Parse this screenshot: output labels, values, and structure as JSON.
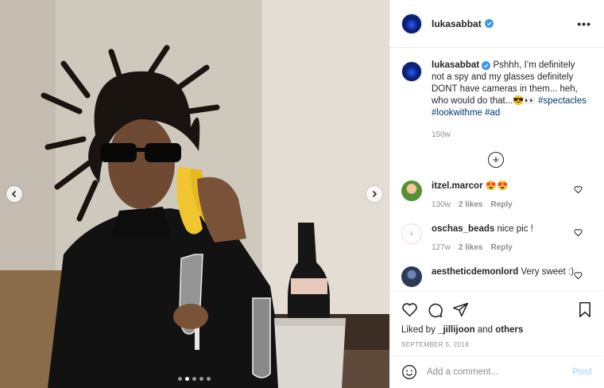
{
  "post": {
    "username": "lukasabbat",
    "verified": true,
    "more_icon": "more-horizontal-icon",
    "caption": {
      "text": "Pshhh, I’m definitely not a spy and my glasses definitely DONT have cameras in them... heh, who would do that...😎👀",
      "hashtags": [
        "#spectacles",
        "#lookwithme",
        "#ad"
      ],
      "time": "150w"
    },
    "load_more_icon": "plus-circle-icon",
    "comments": [
      {
        "username": "itzel.marcor",
        "text": "😍😍",
        "time": "130w",
        "likes": "2 likes",
        "reply": "Reply",
        "avatar_color": "#5a8f3a"
      },
      {
        "username": "oschas_beads",
        "text": "nice pic !",
        "time": "127w",
        "likes": "2 likes",
        "reply": "Reply",
        "avatar_color": "#f3d7e6"
      },
      {
        "username": "aestheticdemonlord",
        "text": "Very sweet :)",
        "time": "",
        "likes": "",
        "reply": "",
        "avatar_color": "#2b3a55"
      }
    ],
    "liked_by": {
      "prefix": "Liked by",
      "user": "_jillijoon",
      "and": "and",
      "others": "others"
    },
    "date": "SEPTEMBER 5, 2018",
    "add_comment_placeholder": "Add a comment...",
    "post_label": "Post"
  },
  "carousel": {
    "total": 5,
    "active_index": 1
  },
  "colors": {
    "link": "#00376b",
    "verified": "#3897f0",
    "muted": "#8e8e8e",
    "post_disabled": "#b2dffc"
  }
}
